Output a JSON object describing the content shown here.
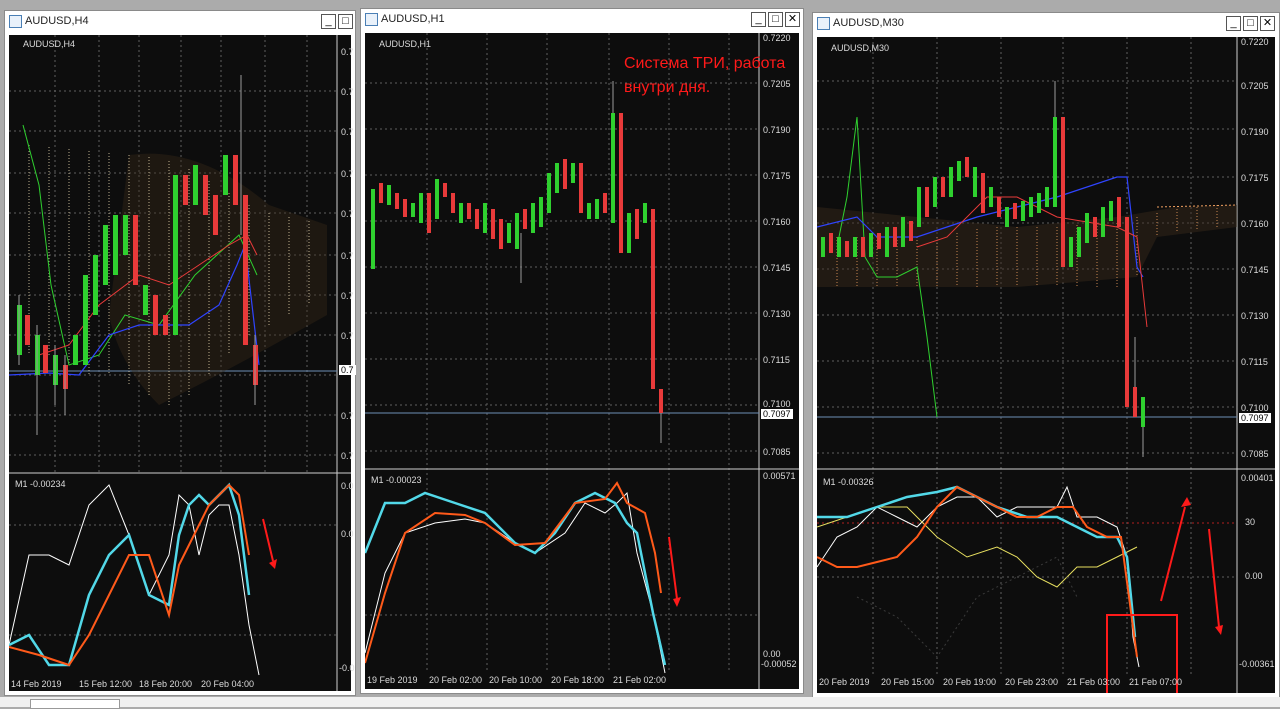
{
  "annotation": {
    "line1": "Система ТРИ, работа",
    "line2": "внутри дня."
  },
  "windows": [
    {
      "title": "AUDUSD,H4",
      "symbol": "AUDUSD,H4",
      "indicator": "M1 -0.00234",
      "price_labels": [
        "0.7",
        "0.7",
        "0.7",
        "0.7",
        "0.7",
        "0.7",
        "0.7",
        "0.7",
        "0.7",
        "0.7",
        "0.7",
        "0.7"
      ],
      "current_price": "0.7",
      "osc_labels": [
        "0.0",
        "0.0",
        "-0.0"
      ],
      "time_labels": [
        "14 Feb 2019",
        "15 Feb 12:00",
        "18 Feb 20:00",
        "20 Feb 04:00"
      ]
    },
    {
      "title": "AUDUSD,H1",
      "symbol": "AUDUSD,H1",
      "indicator": "M1 -0.00023",
      "price_labels": [
        "0.7220",
        "0.7205",
        "0.7190",
        "0.7175",
        "0.7160",
        "0.7145",
        "0.7130",
        "0.7115",
        "0.7100",
        "0.7085"
      ],
      "current_price": "0.7097",
      "osc_labels": [
        "0.00571",
        "0.00",
        "-0.00052"
      ],
      "time_labels": [
        "19 Feb 2019",
        "20 Feb 02:00",
        "20 Feb 10:00",
        "20 Feb 18:00",
        "21 Feb 02:00"
      ]
    },
    {
      "title": "AUDUSD,M30",
      "symbol": "AUDUSD,M30",
      "indicator": "M1 -0.00326",
      "price_labels": [
        "0.7220",
        "0.7205",
        "0.7190",
        "0.7175",
        "0.7160",
        "0.7145",
        "0.7130",
        "0.7115",
        "0.7100",
        "0.7085"
      ],
      "current_price": "0.7097",
      "osc_labels": [
        "0.00401",
        "30",
        "0.00",
        "-0.00361"
      ],
      "time_labels": [
        "20 Feb 2019",
        "20 Feb 15:00",
        "20 Feb 19:00",
        "20 Feb 23:00",
        "21 Feb 03:00",
        "21 Feb 07:00"
      ]
    }
  ],
  "window_buttons": {
    "min": "_",
    "max": "□",
    "close": "✕"
  },
  "colors": {
    "bull": "#2fd02f",
    "bear": "#e83a3a",
    "cyan": "#52d8e8",
    "orange": "#ff5a1a",
    "annotation": "#ff1a1a"
  }
}
